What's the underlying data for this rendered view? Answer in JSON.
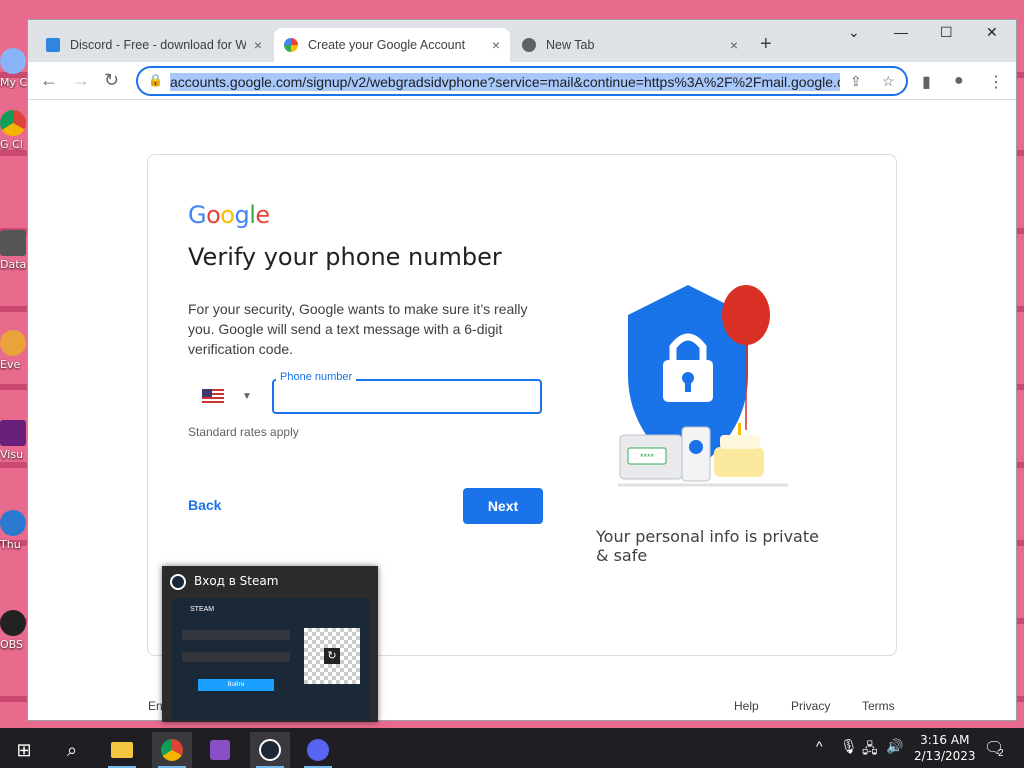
{
  "desktop": {
    "icons": [
      "My C",
      "G\nCl",
      "Data",
      "Eve",
      "Visu",
      "Thu",
      "OBS"
    ]
  },
  "browser": {
    "tabs": [
      {
        "title": "Discord - Free - download for W",
        "favicon": "discord-installer-icon",
        "close": "×"
      },
      {
        "title": "Create your Google Account",
        "favicon": "google-g-icon",
        "close": "×"
      },
      {
        "title": "New Tab",
        "favicon": "chrome-icon",
        "close": "×"
      }
    ],
    "new_tab": "+",
    "url": "accounts.google.com/signup/v2/webgradsidvphone?service=mail&continue=https%3A%2F%2Fmail.google.c"
  },
  "page": {
    "logo": "Google",
    "heading": "Verify your phone number",
    "description": "For your security, Google wants to make sure it’s really you. Google will send a text message with a 6-digit verification code.",
    "phone_label": "Phone number",
    "phone_value": "",
    "rates": "Standard rates apply",
    "back": "Back",
    "next": "Next",
    "privacy": "Your personal info is private & safe",
    "footer": {
      "lang": "Eng",
      "help": "Help",
      "privacy": "Privacy",
      "terms": "Terms"
    },
    "card_code": "****"
  },
  "popup": {
    "title": "Вход в Steam",
    "steam_logo": "STEAM",
    "signin": "Войти"
  },
  "taskbar": {
    "time": "3:16 AM",
    "date": "2/13/2023",
    "notif_count": "2"
  },
  "colors": {
    "accent": "#1a73e8",
    "shield": "#1a73e8",
    "balloon": "#d93025"
  }
}
